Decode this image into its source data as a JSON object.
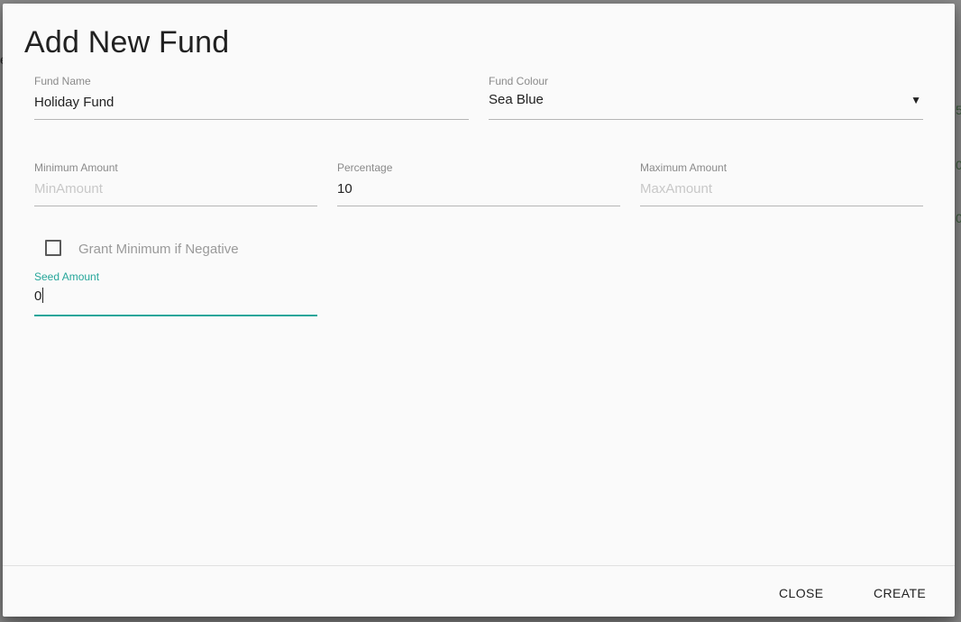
{
  "background": {
    "fragments": [
      "e",
      "5",
      "0",
      "0"
    ]
  },
  "dialog": {
    "title": "Add New Fund",
    "fund_name": {
      "label": "Fund Name",
      "value": "Holiday Fund"
    },
    "fund_colour": {
      "label": "Fund Colour",
      "selected": "Sea Blue",
      "arrow": "▼"
    },
    "minimum_amount": {
      "label": "Minimum Amount",
      "value": "",
      "placeholder": "MinAmount"
    },
    "percentage": {
      "label": "Percentage",
      "value": "10"
    },
    "maximum_amount": {
      "label": "Maximum Amount",
      "value": "",
      "placeholder": "MaxAmount"
    },
    "grant_minimum": {
      "label": "Grant Minimum if Negative",
      "checked": false
    },
    "seed_amount": {
      "label": "Seed Amount",
      "value": "0"
    },
    "actions": {
      "close_label": "CLOSE",
      "create_label": "CREATE"
    }
  },
  "colors": {
    "accent": "#26a69a",
    "dialog_background": "#fafafa",
    "text": "#212121",
    "label": "#8a8a8a"
  }
}
